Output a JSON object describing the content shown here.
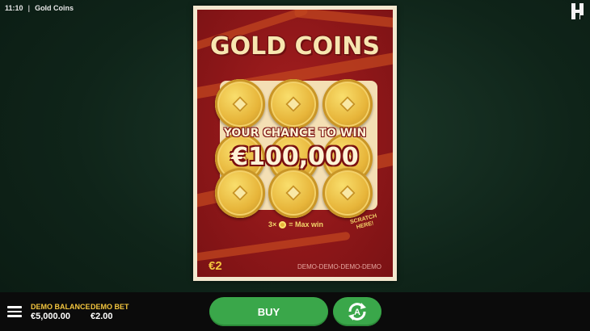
{
  "status": {
    "time": "11:10",
    "separator": "|",
    "game_name": "Gold Coins"
  },
  "card": {
    "title": "GOLD COINS",
    "tagline": "YOUR CHANCE TO WIN",
    "jackpot": "€100,000",
    "maxwin_prefix": "3×",
    "maxwin_suffix": "= Max win",
    "scratch_line1": "SCRATCH",
    "scratch_line2": "HERE!",
    "price": "€2",
    "demo_watermark": "DEMO-DEMO-DEMO-DEMO",
    "coin_count": 9
  },
  "footer": {
    "balance_label": "DEMO BALANCE",
    "balance_value": "€5,000.00",
    "bet_label": "DEMO BET",
    "bet_value": "€2.00",
    "buy_label": "BUY",
    "autoplay_icon": "autoplay-icon",
    "menu_icon": "hamburger-menu-icon"
  },
  "colors": {
    "card_red": "#8e1719",
    "gold": "#e7b53a",
    "buy_green": "#3aa74a",
    "accent_yellow": "#f3c53e"
  }
}
